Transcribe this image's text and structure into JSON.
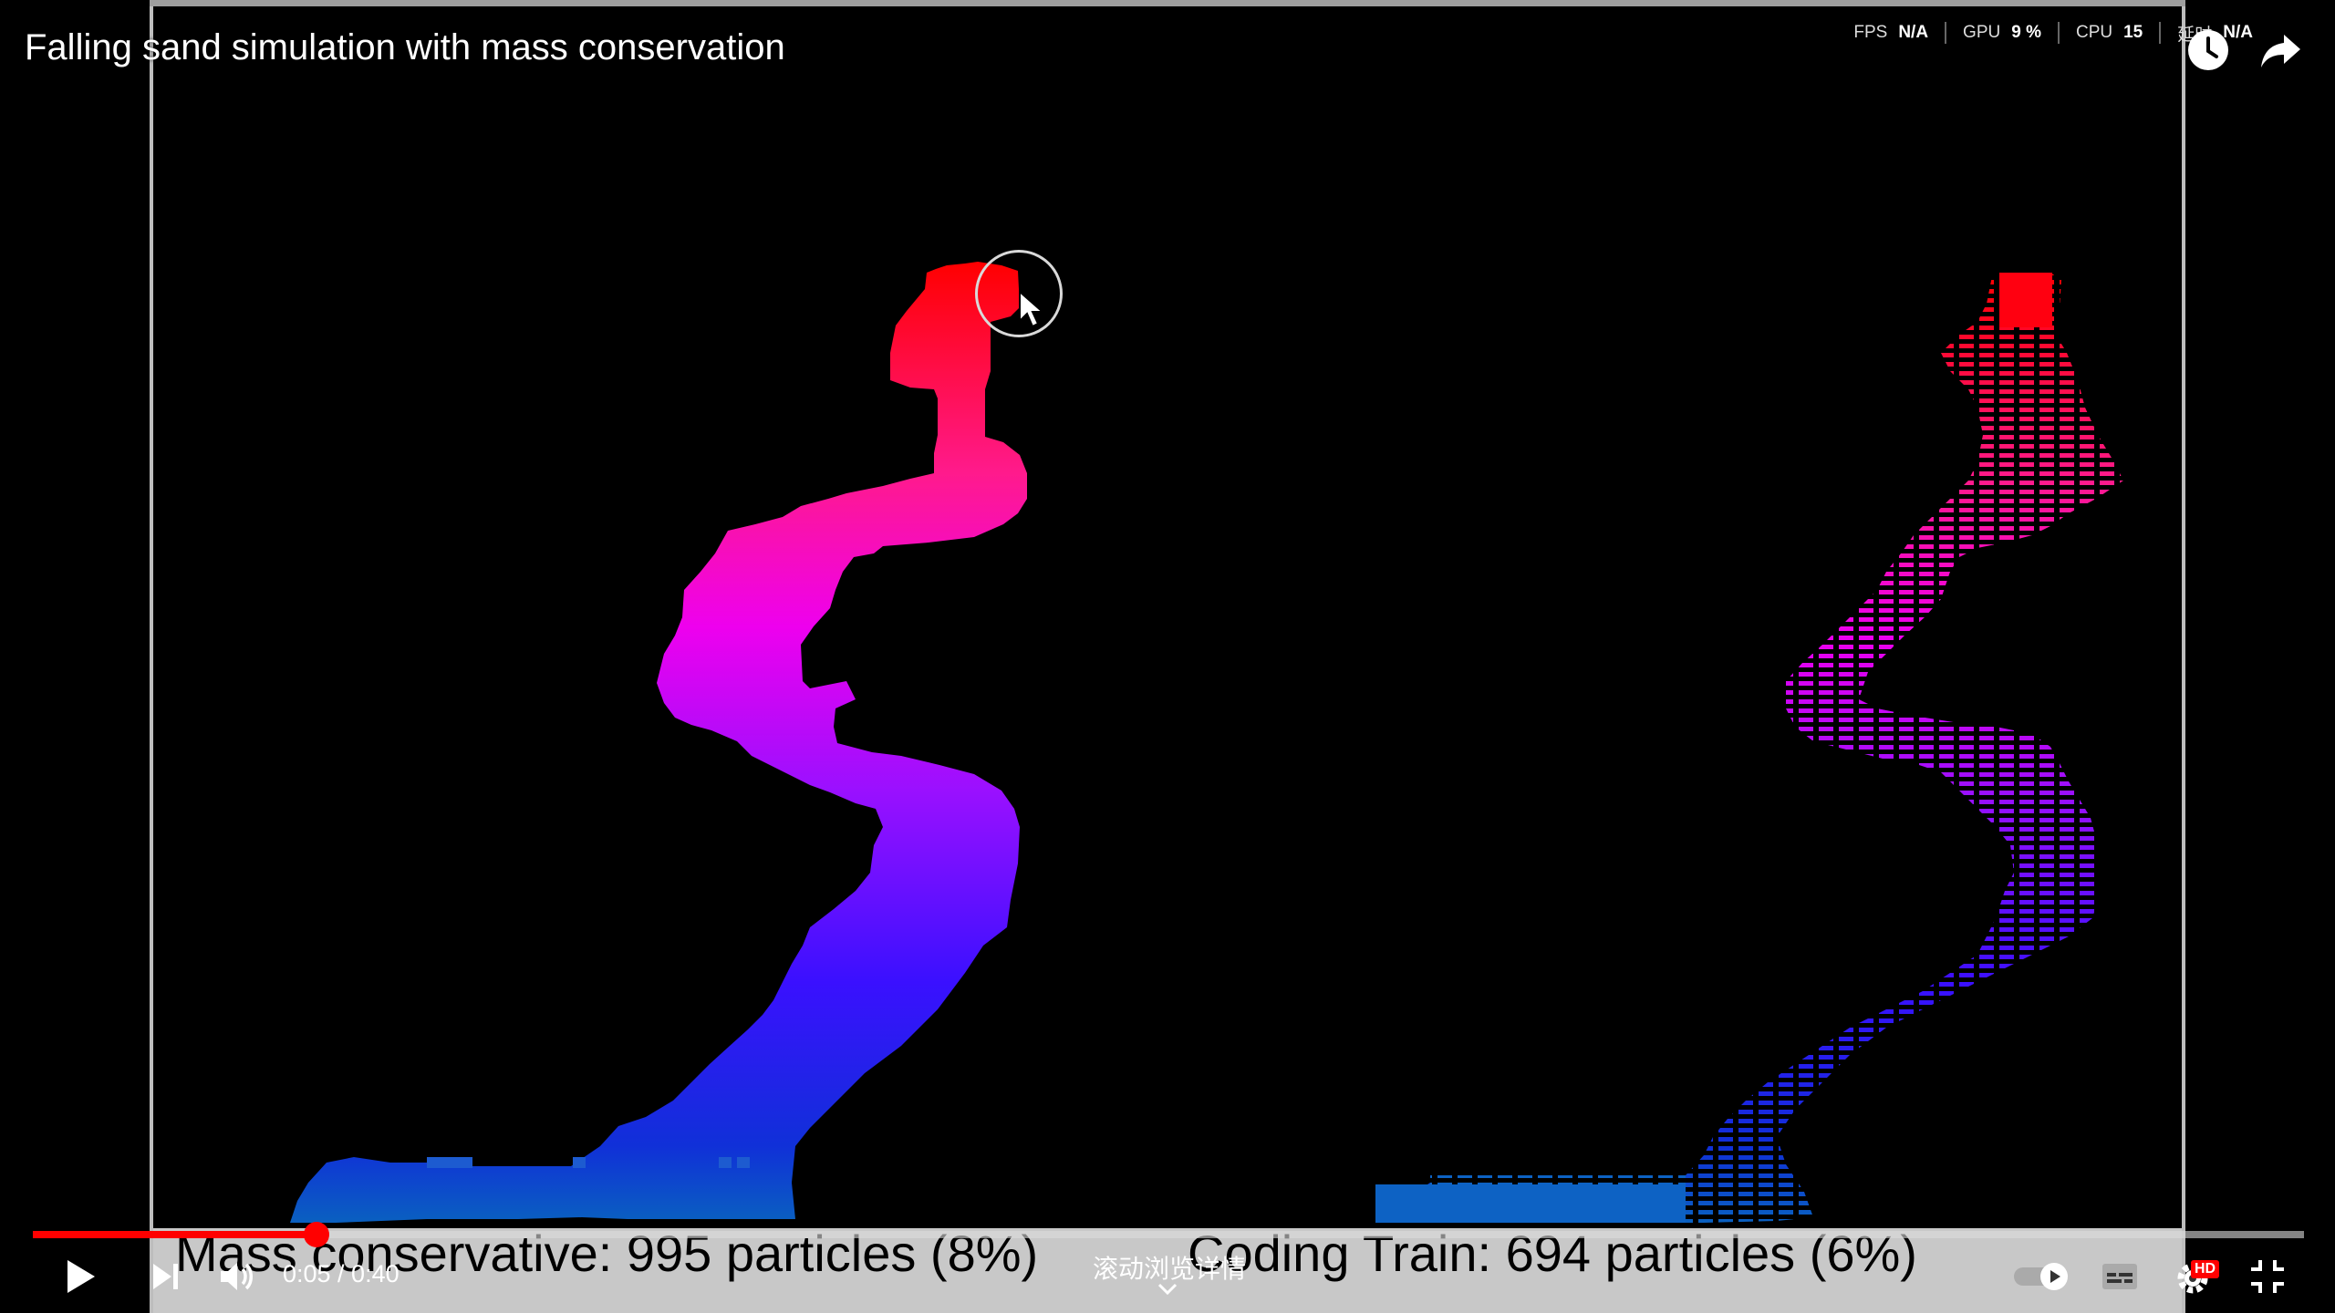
{
  "video": {
    "title": "Falling sand simulation with mass conservation",
    "caption_left": "Mass conservative: 995 particles (8%)",
    "caption_right": "Coding Train: 694 particles (6%)"
  },
  "perf_overlay": {
    "fps_label": "FPS",
    "fps_value": "N/A",
    "gpu_label": "GPU",
    "gpu_value": "9 %",
    "cpu_label": "CPU",
    "cpu_value": "15",
    "latency_label": "延时",
    "latency_value": "N/A"
  },
  "player": {
    "current_time": "0:05",
    "duration": "0:40",
    "time_display": "0:05 / 0:40",
    "progress_fraction": 0.125,
    "scroll_hint": "滚动浏览详情",
    "hd_badge": "HD",
    "accent_color": "#ff0000"
  },
  "icons": [
    "watch-later-icon",
    "share-icon",
    "play-icon",
    "next-icon",
    "volume-icon",
    "autoplay-toggle-icon",
    "subtitles-icon",
    "settings-icon",
    "exit-fullscreen-icon",
    "chevron-down-icon"
  ]
}
